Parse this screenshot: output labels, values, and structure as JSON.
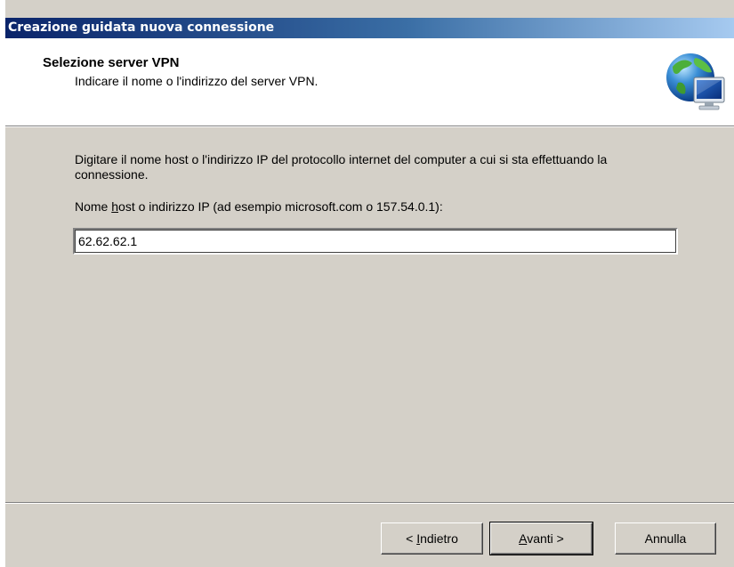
{
  "window": {
    "title": "Creazione guidata nuova connessione"
  },
  "header": {
    "title": "Selezione server VPN",
    "subtitle": "Indicare il nome o l'indirizzo del server VPN.",
    "icon": "globe-monitor-icon"
  },
  "content": {
    "description": "Digitare il nome host o l'indirizzo IP del protocollo internet del computer a cui si sta effettuando la connessione.",
    "field_label_pre": "Nome ",
    "field_label_accel": "h",
    "field_label_post": "ost o indirizzo IP (ad esempio microsoft.com o 157.54.0.1):",
    "host_value": "62.62.62.1"
  },
  "buttons": {
    "back_pre": "< ",
    "back_accel": "I",
    "back_post": "ndietro",
    "next_accel": "A",
    "next_post": "vanti >",
    "cancel": "Annulla"
  },
  "colors": {
    "title_bar_start": "#0a246a",
    "title_bar_end": "#a6caf0",
    "dialog_face": "#d4d0c8"
  }
}
